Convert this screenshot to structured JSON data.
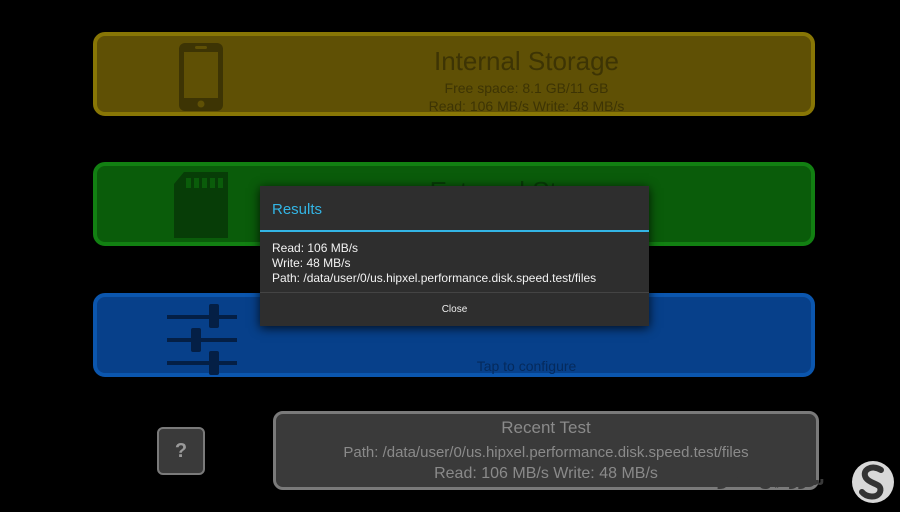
{
  "cards": {
    "internal": {
      "title": "Internal Storage",
      "free_space": "Free space: 8.1 GB/11 GB",
      "speeds": "Read: 106 MB/s Write: 48 MB/s",
      "icon": "smartphone-icon"
    },
    "external": {
      "title": "External Storage",
      "icon": "sd-card-icon"
    },
    "settings": {
      "hint": "Tap to configure",
      "icon": "sliders-icon"
    }
  },
  "help_button": {
    "label": "?"
  },
  "recent_test": {
    "title": "Recent Test",
    "path": "Path: /data/user/0/us.hipxel.performance.disk.speed.test/files",
    "speeds": "Read: 106 MB/s Write: 48 MB/s"
  },
  "dialog": {
    "title": "Results",
    "read": "Read: 106 MB/s",
    "write": "Write: 48 MB/s",
    "path": "Path: /data/user/0/us.hipxel.performance.disk.speed.test/files",
    "close_label": "Close"
  },
  "watermark": {
    "text": "سرزمین دانلود"
  },
  "colors": {
    "accent": "#33b5e5",
    "internal_card": "#5f5005",
    "external_card": "#0a5c0a",
    "settings_card": "#07408a",
    "dialog_bg": "#2e2e2e"
  }
}
